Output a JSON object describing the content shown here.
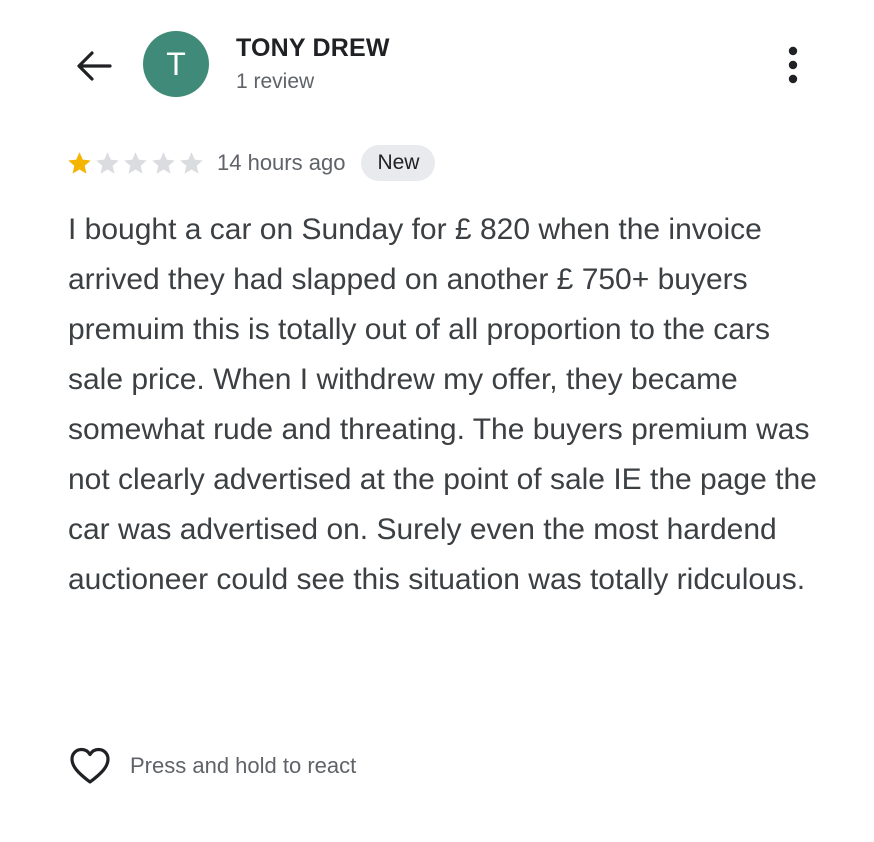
{
  "header": {
    "back_icon": "arrow-left-icon",
    "avatar_letter": "T",
    "avatar_color": "#3f8a78",
    "reviewer_name": "TONY DREW",
    "review_count": "1 review",
    "more_icon": "more-vert-icon"
  },
  "review": {
    "rating": 1,
    "rating_max": 5,
    "star_filled_color": "#f4b400",
    "star_empty_color": "#dadce0",
    "time_ago": "14 hours ago",
    "badge": "New",
    "text": "I bought a car on Sunday for £ 820 when the invoice arrived they had slapped on another £ 750+ buyers premuim this is totally out of all proportion to the cars sale price. When I withdrew my offer, they became somewhat rude and threating. The buyers premium was not clearly advertised at the point of sale IE the page the car was advertised on. Surely even the most hardend auctioneer could see this situation was totally ridculous."
  },
  "reaction": {
    "icon": "heart-outline-icon",
    "label": "Press and hold to react"
  }
}
